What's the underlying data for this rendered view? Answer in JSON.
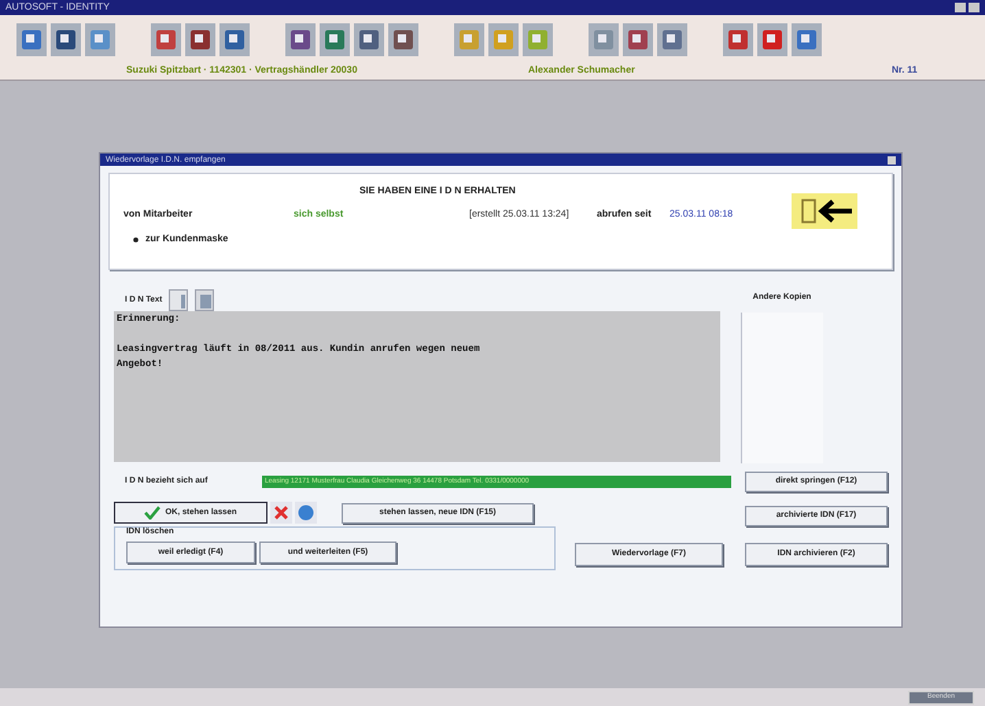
{
  "window": {
    "title": "AUTOSOFT - IDENTITY"
  },
  "status_line": {
    "dealer": "Suzuki Spitzbart · 1142301 · Vertragshändler 20030",
    "user": "Alexander Schumacher",
    "number": "Nr. 11"
  },
  "dialog": {
    "title": "Wiedervorlage I.D.N. empfangen",
    "heading": "SIE HABEN EINE I D N ERHALTEN",
    "from_label": "von Mitarbeiter",
    "from_value": "sich selbst",
    "created": "[erstellt 25.03.11 13:24]",
    "since_label": "abrufen seit",
    "since_value": "25.03.11 08:18",
    "customer_mask": {
      "label": "zur Kundenmaske",
      "checked": true
    },
    "text_label": "I D N Text",
    "text_paragraphs": [
      "Erinnerung:",
      "Leasingvertrag läuft in 08/2011 aus. Kundin anrufen wegen neuem\nAngebot!"
    ],
    "copies_label": "Andere Kopien",
    "reference_label": "I D N bezieht sich auf",
    "reference_value": "Leasing 12171 Musterfrau Claudia Gleichenweg 36 14478 Potsdam Tel. 0331/0000000",
    "buttons": {
      "jump": "direkt springen (F12)",
      "ok": "OK, stehen lassen",
      "new": "stehen lassen, neue IDN (F15)",
      "archived": "archivierte IDN (F17)",
      "resubmit": "Wiedervorlage (F7)",
      "archive": "IDN archivieren (F2)"
    },
    "delete_group": {
      "title": "IDN löschen",
      "buttons": [
        "weil erledigt (F4)",
        "und weiterleiten (F5)"
      ]
    }
  },
  "bottom_button": "Beenden"
}
